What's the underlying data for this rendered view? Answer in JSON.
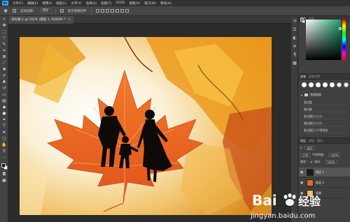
{
  "app": {
    "logo": "Ps"
  },
  "menubar": {
    "items": [
      "文件(F)",
      "编辑(E)",
      "图像(I)",
      "图层(L)",
      "文字(Y)",
      "选择(S)",
      "滤镜(T)",
      "3D(D)",
      "视图(V)",
      "窗口(W)",
      "帮助(H)"
    ]
  },
  "options": {
    "auto_select_label": "自动选择：",
    "auto_select_value": "图层",
    "transform_label": "显示变换控件",
    "move_icon": "move-icon"
  },
  "document": {
    "tab_title": "未标题-1 @ 162% (图层 1, RGB/8) *",
    "tab_close": "×"
  },
  "color_panel": {
    "tabs": [
      "颜色",
      "色板"
    ],
    "foreground": "#21a874",
    "background": "#ffffff"
  },
  "brush_panel": {
    "tabs": [
      "画笔",
      "画笔设置"
    ],
    "group_label": "常规画笔",
    "items": [
      "柔边圆",
      "硬边圆",
      "柔边圆压力大小",
      "硬边圆压力大小",
      "柔边圆压力不透明度"
    ]
  },
  "layers_panel": {
    "tabs": [
      "图层",
      "通道",
      "路径"
    ],
    "kind_label": "类型",
    "blend_mode": "正常",
    "opacity_label": "不透明度：",
    "opacity_value": "100%",
    "lock_label": "锁定：",
    "fill_label": "填充：",
    "fill_value": "100%",
    "layers": [
      {
        "name": "图层 1",
        "active": true
      },
      {
        "name": "图层 2",
        "active": false
      },
      {
        "name": "背景",
        "active": false
      }
    ]
  },
  "watermark": {
    "brand": "Bai",
    "brand2": "经验",
    "url": "jingyan.baidu.com"
  }
}
